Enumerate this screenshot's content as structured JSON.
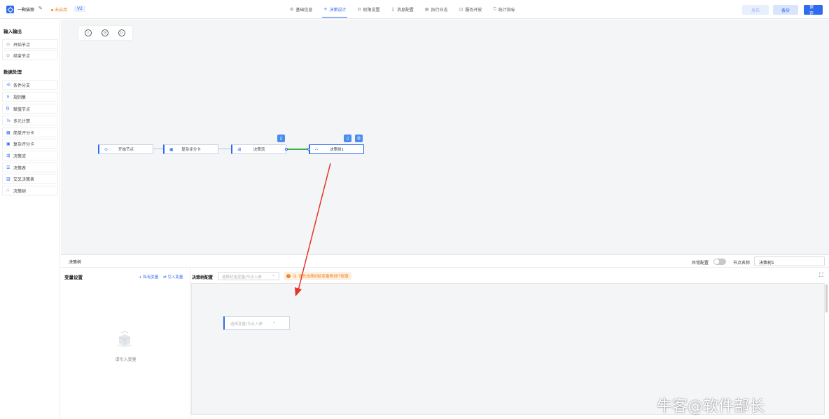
{
  "header": {
    "app_name": "一颗猫粮",
    "status": "未启用",
    "version": "V2",
    "tabs": [
      {
        "label": "基础信息",
        "icon": "gear-icon"
      },
      {
        "label": "决策设计",
        "icon": "move-icon"
      },
      {
        "label": "权限设置",
        "icon": "lock-icon"
      },
      {
        "label": "消息配置",
        "icon": "headset-icon"
      },
      {
        "label": "执行日志",
        "icon": "log-icon"
      },
      {
        "label": "服务开放",
        "icon": "book-icon"
      },
      {
        "label": "统计指标",
        "icon": "shield-icon"
      }
    ],
    "buttons": {
      "publish": "发布",
      "backup": "备份",
      "save": "保存"
    }
  },
  "sidebar": {
    "groups": [
      {
        "title": "输入输出",
        "items": [
          "开始节点",
          "结束节点"
        ]
      },
      {
        "title": "数据处理",
        "items": [
          "条件分支",
          "规则集",
          "赋值节点",
          "多元计算",
          "简单评分卡",
          "复杂评分卡",
          "决策流",
          "决策表",
          "交叉决策表",
          "决策树"
        ]
      }
    ]
  },
  "canvas": {
    "tools": [
      "i",
      "◷",
      "▷"
    ],
    "nodes": [
      "开始节点",
      "复杂评分卡",
      "决策流",
      "决策树1"
    ]
  },
  "bottom_panel": {
    "tab": "决策树",
    "exception_label": "异常配置",
    "node_name_label": "节点名称",
    "node_name_value": "决策树1",
    "variables": {
      "title": "变量设置",
      "private_var": "+ 私有变量",
      "import_var": "⇄ 引入变量",
      "empty_text": "请引入变量"
    },
    "tree_config": {
      "title": "决策树配置",
      "select_placeholder": "选择初始变量/节点入参",
      "warning_tag": "注",
      "warning_text": "请先选择初始变量再进行配置",
      "node_placeholder": "选择变量/节点入参"
    }
  },
  "watermark": "牛客@软件部长",
  "colors": {
    "accent": "#2f6bef",
    "warning": "#f2811d",
    "connector_active": "#3bb34a",
    "annotation_arrow": "#e5352b"
  }
}
